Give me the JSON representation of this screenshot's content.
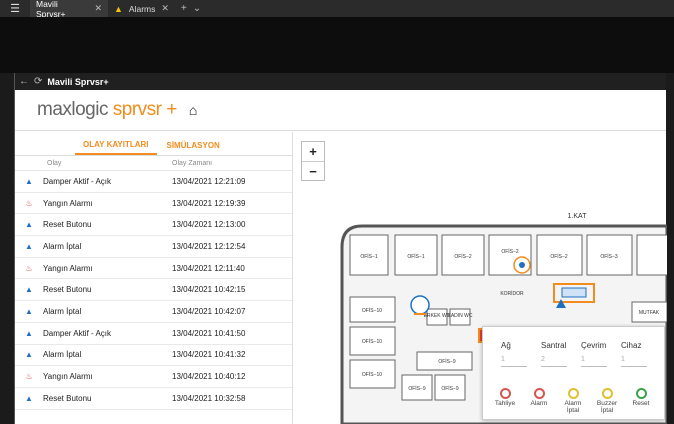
{
  "browser": {
    "tabs": [
      {
        "label": "Mavili Sprvsr+"
      },
      {
        "label": "Alarms"
      }
    ]
  },
  "app": {
    "title": "Mavili Sprvsr+",
    "brand_main": "maxlogic ",
    "brand_accent": "sprvsr +",
    "colors": {
      "accent": "#f28c1e",
      "info": "#1f6fc2",
      "fire": "#e53935"
    }
  },
  "panel": {
    "tabs": [
      "OLAY KAYITLARI",
      "SİMÜLASYON"
    ],
    "headers": [
      "Olay",
      "Olay Zamanı"
    ],
    "rows": [
      {
        "icon": "info",
        "name": "Damper Aktif - Açık",
        "time": "13/04/2021 12:21:09"
      },
      {
        "icon": "fire",
        "name": "Yangın Alarmı",
        "time": "13/04/2021 12:19:39"
      },
      {
        "icon": "info",
        "name": "Reset Butonu",
        "time": "13/04/2021 12:13:00"
      },
      {
        "icon": "info",
        "name": "Alarm İptal",
        "time": "13/04/2021 12:12:54"
      },
      {
        "icon": "fire",
        "name": "Yangın Alarmı",
        "time": "13/04/2021 12:11:40"
      },
      {
        "icon": "info",
        "name": "Reset Butonu",
        "time": "13/04/2021 10:42:15"
      },
      {
        "icon": "info",
        "name": "Alarm İptal",
        "time": "13/04/2021 10:42:07"
      },
      {
        "icon": "info",
        "name": "Damper Aktif - Açık",
        "time": "13/04/2021 10:41:50"
      },
      {
        "icon": "info",
        "name": "Alarm İptal",
        "time": "13/04/2021 10:41:32"
      },
      {
        "icon": "fire",
        "name": "Yangın Alarmı",
        "time": "13/04/2021 10:40:12"
      },
      {
        "icon": "info",
        "name": "Reset Butonu",
        "time": "13/04/2021 10:32:58"
      }
    ]
  },
  "map": {
    "zoom_in": "+",
    "zoom_out": "−",
    "floor_label": "1.KAT",
    "rooms": {
      "ofis1a": "OFİS−1",
      "ofis1b": "OFİS−1",
      "ofis2a": "OFİS−2",
      "ofis2b": "OFİS−2",
      "ofis2c": "OFİS−2",
      "ofis3": "OFİS−3",
      "ofis10a": "OFİS−10",
      "ofis10b": "OFİS−10",
      "ofis10c": "OFİS−10",
      "ofis9a": "OFİS−9",
      "ofis9b": "OFİS−9",
      "ofis9c": "OFİS−9",
      "koridor": "KORİDOR",
      "erkek_wc": "ERKEK WC",
      "kadin_wc": "KADIN WC",
      "mutfak": "MUTFAK"
    }
  },
  "controls": {
    "fields": [
      {
        "label": "Ağ",
        "value": "1"
      },
      {
        "label": "Santral",
        "value": "2"
      },
      {
        "label": "Çevrim",
        "value": "1"
      },
      {
        "label": "Cihaz",
        "value": "1"
      }
    ],
    "buttons": [
      {
        "label": "Tahliye",
        "color": "#d9534f"
      },
      {
        "label": "Alarm",
        "color": "#d9534f"
      },
      {
        "label": "Alarm İptal",
        "color": "#e0c030"
      },
      {
        "label": "Buzzer İptal",
        "color": "#e0c030"
      },
      {
        "label": "Reset",
        "color": "#3aa34a"
      }
    ]
  }
}
